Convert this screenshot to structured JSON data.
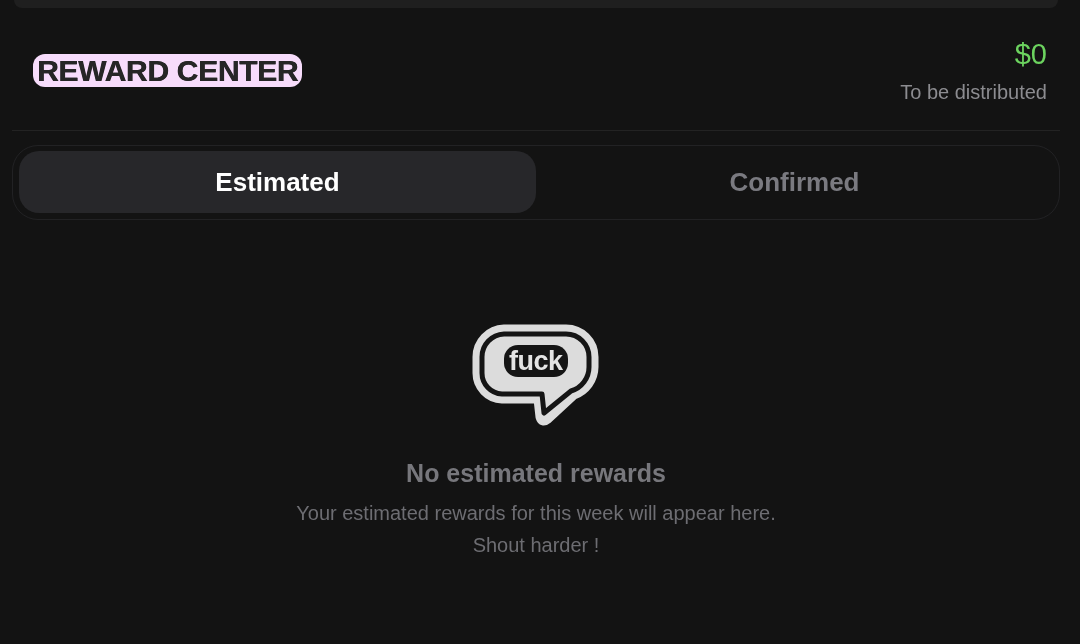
{
  "header": {
    "title": "REWARD CENTER",
    "amount": "$0",
    "amount_caption": "To be distributed"
  },
  "tabs": [
    {
      "label": "Estimated",
      "selected": true
    },
    {
      "label": "Confirmed",
      "selected": false
    }
  ],
  "empty_state": {
    "logo_text": "fuck",
    "title": "No estimated rewards",
    "lines": [
      "Your estimated rewards for this week will appear here.",
      "Shout harder !"
    ]
  }
}
